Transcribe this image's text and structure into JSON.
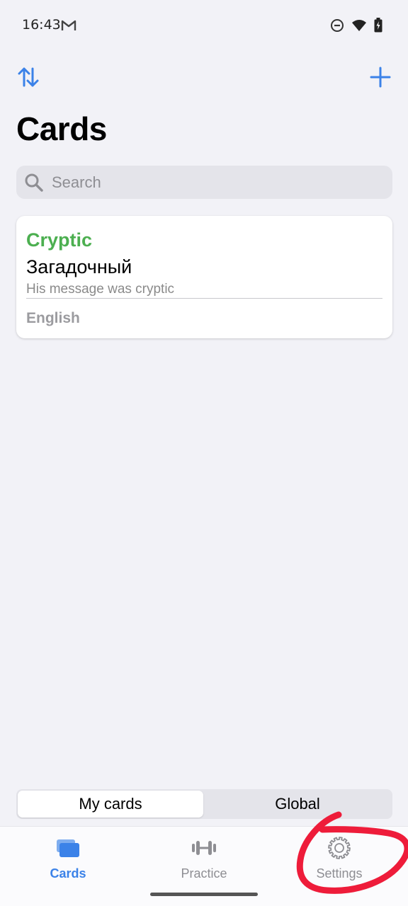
{
  "status_bar": {
    "time": "16:43",
    "icons": [
      "gmail-icon",
      "do-not-disturb-icon",
      "wifi-icon",
      "battery-icon"
    ]
  },
  "toolbar": {
    "sort_icon": "sort-arrows-icon",
    "add_icon": "plus-icon"
  },
  "page": {
    "title": "Cards"
  },
  "search": {
    "placeholder": "Search",
    "value": ""
  },
  "cards": [
    {
      "word": "Cryptic",
      "translation": "Загадочный",
      "example": "His message was cryptic",
      "language": "English"
    }
  ],
  "segmented": {
    "options": [
      "My cards",
      "Global"
    ],
    "selected": "My cards"
  },
  "tab_bar": {
    "items": [
      {
        "label": "Cards",
        "icon": "cards-stack-icon",
        "active": true
      },
      {
        "label": "Practice",
        "icon": "dumbbell-icon",
        "active": false
      },
      {
        "label": "Settings",
        "icon": "gear-icon",
        "active": false
      }
    ]
  },
  "colors": {
    "accent": "#3b82e8",
    "word": "#4caf50",
    "background": "#f2f2f7",
    "annotation": "#ee1c3a"
  }
}
